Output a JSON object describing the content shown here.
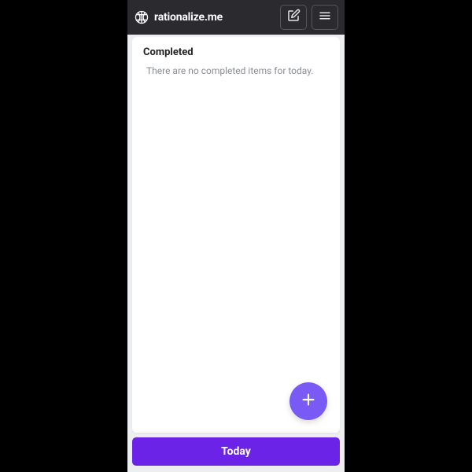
{
  "header": {
    "brand_name": "rationalize.me"
  },
  "main": {
    "section_title": "Completed",
    "empty_message": "There are no completed items for today."
  },
  "footer": {
    "today_label": "Today"
  }
}
